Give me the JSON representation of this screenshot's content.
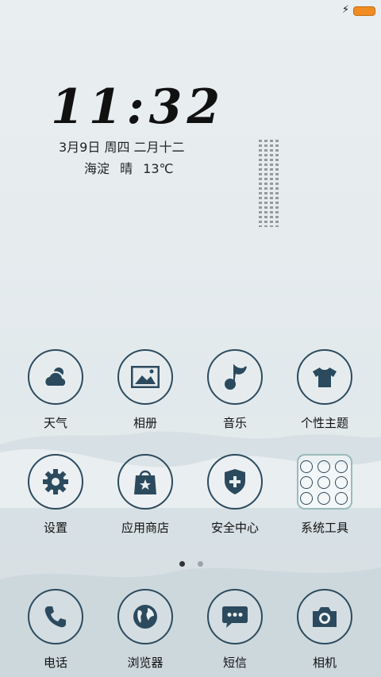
{
  "status": {
    "charging_icon": "bolt-icon",
    "battery_color": "#f08c22"
  },
  "lockscreen": {
    "time": "11:32",
    "date": "3月9日  周四  二月十二",
    "weather": "海淀  晴  13℃"
  },
  "apps_row1": [
    {
      "label": "天气",
      "icon": "weather-icon"
    },
    {
      "label": "相册",
      "icon": "gallery-icon"
    },
    {
      "label": "音乐",
      "icon": "music-icon"
    },
    {
      "label": "个性主题",
      "icon": "theme-icon"
    }
  ],
  "apps_row2": [
    {
      "label": "设置",
      "icon": "settings-icon"
    },
    {
      "label": "应用商店",
      "icon": "store-icon"
    },
    {
      "label": "安全中心",
      "icon": "security-icon"
    },
    {
      "label": "系统工具",
      "icon": "tools-folder-icon"
    }
  ],
  "dock": [
    {
      "label": "电话",
      "icon": "phone-icon"
    },
    {
      "label": "浏览器",
      "icon": "browser-icon"
    },
    {
      "label": "短信",
      "icon": "messages-icon"
    },
    {
      "label": "相机",
      "icon": "camera-icon"
    }
  ],
  "pager": {
    "pages": 2,
    "current": 1,
    "active_color": "#333333",
    "inactive_color": "#9aa5ab"
  },
  "colors": {
    "icon_stroke": "#2c4a5e",
    "icon_fill": "#2c4a5e"
  }
}
